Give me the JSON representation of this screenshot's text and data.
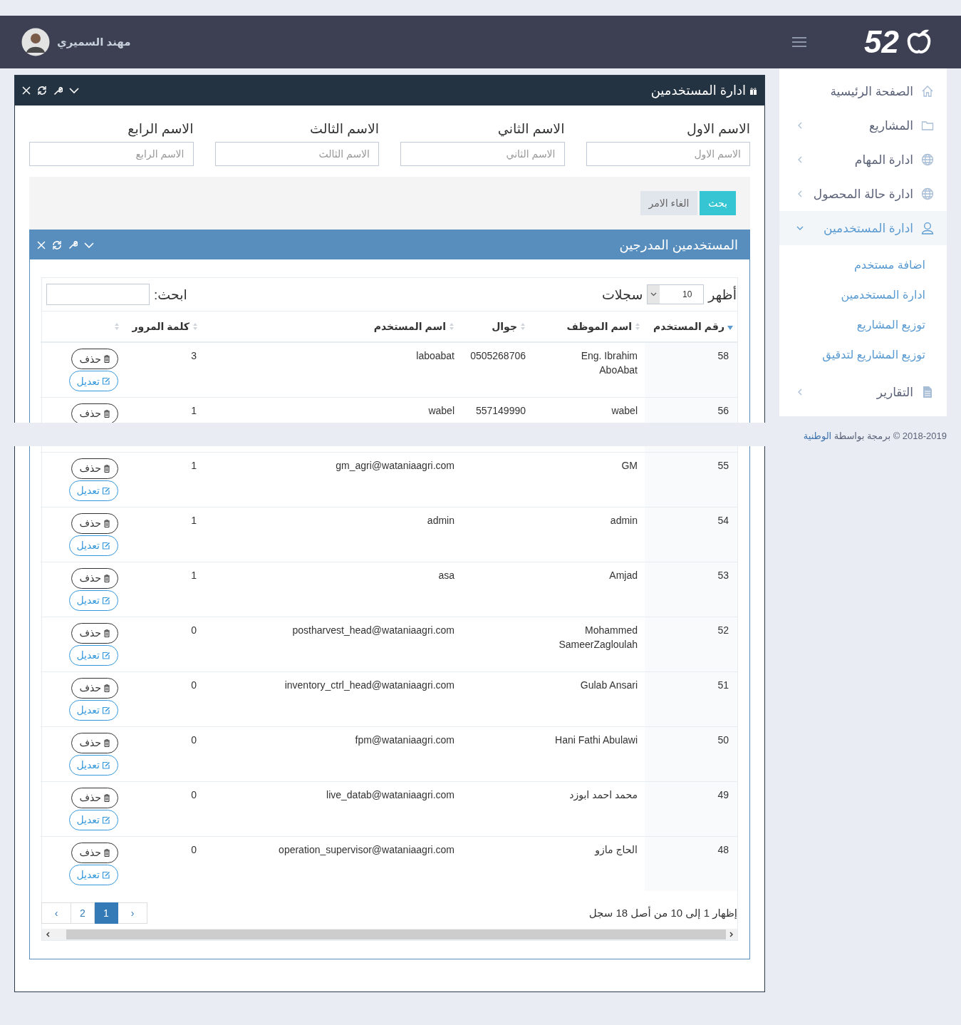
{
  "header": {
    "logo_text": "52",
    "user_name": "مهند السميري"
  },
  "sidebar": {
    "items": [
      {
        "label": "الصفحة الرئيسية",
        "has_children": false,
        "selected": false
      },
      {
        "label": "المشاريع",
        "has_children": true,
        "expanded": false,
        "selected": false
      },
      {
        "label": "ادارة المهام",
        "has_children": true,
        "expanded": false,
        "selected": false
      },
      {
        "label": "ادارة حالة المحصول",
        "has_children": true,
        "expanded": false,
        "selected": false
      },
      {
        "label": "ادارة المستخدمين",
        "has_children": true,
        "expanded": true,
        "selected": true,
        "children": [
          {
            "label": "اضافة مستخدم",
            "selected": false
          },
          {
            "label": "ادارة المستخدمين",
            "selected": false
          },
          {
            "label": "توزيع المشاريع",
            "selected": false
          },
          {
            "label": "توزيع المشاريع لتدقيق",
            "selected": false
          }
        ]
      },
      {
        "label": "التقارير",
        "has_children": true,
        "expanded": false,
        "selected": false
      }
    ]
  },
  "footer": {
    "text": "2018-2019 © برمجة بواسطة",
    "link": "الوطنية"
  },
  "main_panel": {
    "title": "ادارة المستخدمين",
    "filters": [
      {
        "label": "الاسم الاول",
        "placeholder": "الاسم الاول"
      },
      {
        "label": "الاسم الثاني",
        "placeholder": "الاسم الثاني"
      },
      {
        "label": "الاسم الثالث",
        "placeholder": "الاسم الثالث"
      },
      {
        "label": "الاسم الرابع",
        "placeholder": "الاسم الرابع"
      }
    ],
    "buttons": [
      {
        "kind": "primary",
        "label": "بحث"
      },
      {
        "kind": "default",
        "label": "الغاء الامر"
      }
    ],
    "users_panel": {
      "title": "المستخدمين المدرجين",
      "length_before": "أظهر",
      "page_length": "10",
      "length_after": "سجلات",
      "search_label": "ابحث:",
      "columns": [
        {
          "label": "رقم المستخدم",
          "sorted": true
        },
        {
          "label": "اسم الموظف",
          "sorted": false
        },
        {
          "label": "جوال",
          "sorted": false
        },
        {
          "label": "اسم المستخدم",
          "sorted": false
        },
        {
          "label": "كلمة المرور",
          "sorted": false
        },
        {
          "sorted": false
        }
      ],
      "rows": [
        {
          "id": "58",
          "name": "Eng. Ibrahim AboAbat",
          "mobile": "0505268706",
          "username": "laboabat",
          "password": "3",
          "actions": [
            {
              "kind": "delete",
              "label": "حذف"
            },
            {
              "kind": "edit",
              "label": "تعديل"
            }
          ]
        },
        {
          "id": "56",
          "name": "wabel",
          "mobile": "557149990",
          "username": "wabel",
          "password": "1",
          "actions": [
            {
              "kind": "delete",
              "label": "حذف"
            }
          ]
        },
        {
          "id": "55",
          "name": "GM",
          "username": "gm_agri@wataniaagri.com",
          "password": "1",
          "actions": [
            {
              "kind": "delete",
              "label": "حذف"
            },
            {
              "kind": "edit",
              "label": "تعديل"
            }
          ]
        },
        {
          "id": "54",
          "name": "admin",
          "username": "admin",
          "password": "1",
          "actions": [
            {
              "kind": "delete",
              "label": "حذف"
            },
            {
              "kind": "edit",
              "label": "تعديل"
            }
          ]
        },
        {
          "id": "53",
          "name": "Amjad",
          "username": "asa",
          "password": "1",
          "actions": [
            {
              "kind": "delete",
              "label": "حذف"
            },
            {
              "kind": "edit",
              "label": "تعديل"
            }
          ]
        },
        {
          "id": "52",
          "name": "Mohammed SameerZagloulah",
          "username": "postharvest_head@wataniaagri.com",
          "password": "0",
          "actions": [
            {
              "kind": "delete",
              "label": "حذف"
            },
            {
              "kind": "edit",
              "label": "تعديل"
            }
          ]
        },
        {
          "id": "51",
          "name": "Gulab Ansari",
          "username": "inventory_ctrl_head@wataniaagri.com",
          "password": "0",
          "actions": [
            {
              "kind": "delete",
              "label": "حذف"
            },
            {
              "kind": "edit",
              "label": "تعديل"
            }
          ]
        },
        {
          "id": "50",
          "name": "Hani Fathi Abulawi",
          "username": "fpm@wataniaagri.com",
          "password": "0",
          "actions": [
            {
              "kind": "delete",
              "label": "حذف"
            },
            {
              "kind": "edit",
              "label": "تعديل"
            }
          ]
        },
        {
          "id": "49",
          "name": "محمد احمد ابوزد",
          "username": "live_datab@wataniaagri.com",
          "password": "0",
          "actions": [
            {
              "kind": "delete",
              "label": "حذف"
            },
            {
              "kind": "edit",
              "label": "تعديل"
            }
          ]
        },
        {
          "id": "48",
          "name": "الحاج مازو",
          "username": "operation_supervisor@wataniaagri.com",
          "password": "0",
          "actions": [
            {
              "kind": "delete",
              "label": "حذف"
            },
            {
              "kind": "edit",
              "label": "تعديل"
            }
          ]
        }
      ],
      "info": "إظهار 1 إلى 10 من أصل 18 سجل",
      "pagination": [
        {
          "label": "›",
          "selected": false
        },
        {
          "label": "1",
          "selected": true
        },
        {
          "label": "2",
          "selected": false
        },
        {
          "label": "‹",
          "selected": false
        }
      ]
    }
  }
}
